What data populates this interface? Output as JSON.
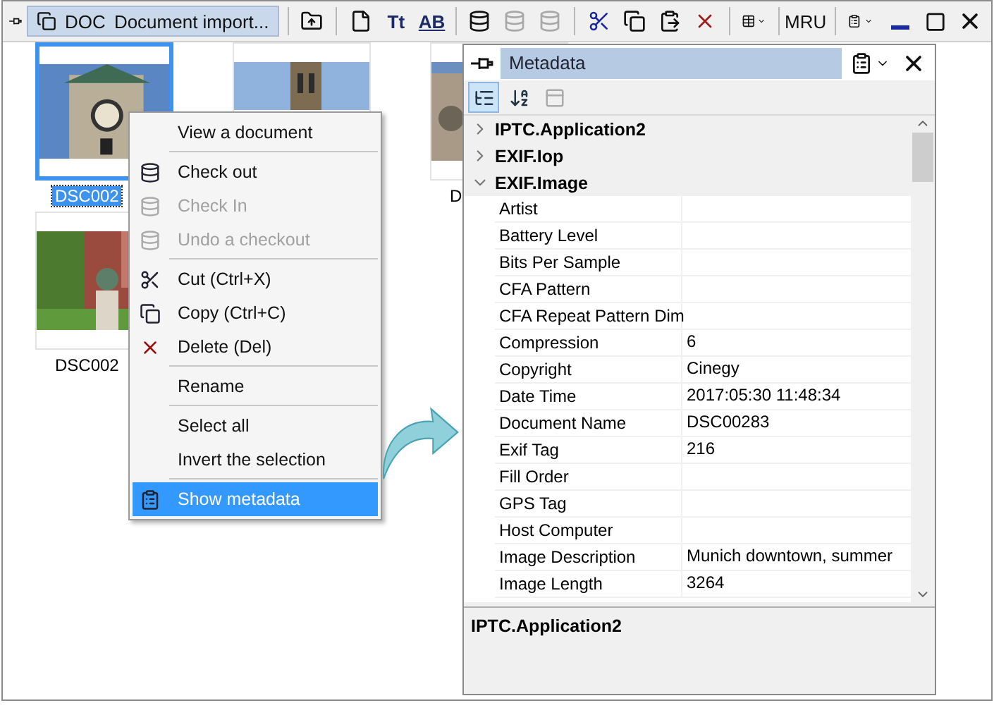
{
  "toolbar": {
    "tab": {
      "code": "DOC",
      "label": "Document import..."
    },
    "buttons": [
      {
        "kind": "icon",
        "disabled": false
      },
      {
        "kind": "separator"
      },
      {
        "kind": "icon",
        "disabled": false
      },
      {
        "kind": "glyph",
        "label": "Tt"
      },
      {
        "kind": "glyph",
        "label": "AB"
      },
      {
        "kind": "separator"
      },
      {
        "kind": "icon",
        "disabled": false
      },
      {
        "kind": "icon",
        "disabled": true
      },
      {
        "kind": "icon",
        "disabled": true
      },
      {
        "kind": "separator"
      },
      {
        "kind": "icon",
        "disabled": false
      },
      {
        "kind": "icon",
        "disabled": false
      },
      {
        "kind": "icon",
        "disabled": false
      },
      {
        "kind": "icon",
        "disabled": false
      },
      {
        "kind": "separator"
      },
      {
        "kind": "icon",
        "disabled": false
      },
      {
        "kind": "separator"
      },
      {
        "kind": "text",
        "label": "MRU"
      },
      {
        "kind": "separator"
      },
      {
        "kind": "icon",
        "disabled": false
      }
    ]
  },
  "thumbnails": [
    {
      "label": "DSC002",
      "selected": true
    },
    {
      "selected": false
    },
    {
      "label": "D",
      "selected": false
    },
    {
      "label": "DSC002",
      "selected": false
    }
  ],
  "context_menu": [
    {
      "kind": "item",
      "label": "View a document",
      "disabled": false,
      "selected": false
    },
    {
      "kind": "separator"
    },
    {
      "kind": "item",
      "label": "Check out",
      "disabled": false,
      "selected": false
    },
    {
      "kind": "item",
      "label": "Check In",
      "disabled": true,
      "selected": false
    },
    {
      "kind": "item",
      "label": "Undo a checkout",
      "disabled": true,
      "selected": false
    },
    {
      "kind": "separator"
    },
    {
      "kind": "item",
      "label": "Cut (Ctrl+X)",
      "disabled": false,
      "selected": false
    },
    {
      "kind": "item",
      "label": "Copy (Ctrl+C)",
      "disabled": false,
      "selected": false
    },
    {
      "kind": "item",
      "label": "Delete (Del)",
      "disabled": false,
      "selected": false
    },
    {
      "kind": "separator"
    },
    {
      "kind": "item",
      "label": "Rename",
      "disabled": false,
      "selected": false
    },
    {
      "kind": "separator"
    },
    {
      "kind": "item",
      "label": "Select all",
      "disabled": false,
      "selected": false
    },
    {
      "kind": "item",
      "label": "Invert the selection",
      "disabled": false,
      "selected": false
    },
    {
      "kind": "separator"
    },
    {
      "kind": "item",
      "label": "Show metadata",
      "disabled": false,
      "selected": true
    }
  ],
  "metadata_panel": {
    "title": "Metadata",
    "toolbar": [
      {
        "kind": "categorized",
        "selected": true,
        "disabled": false
      },
      {
        "kind": "alphabetical",
        "selected": false,
        "disabled": false
      },
      {
        "kind": "pages",
        "selected": false,
        "disabled": true
      }
    ],
    "categories": [
      {
        "name": "IPTC.Application2",
        "expanded": false
      },
      {
        "name": "EXIF.Iop",
        "expanded": false
      },
      {
        "name": "EXIF.Image",
        "expanded": true,
        "children": [
          {
            "name": "Artist"
          },
          {
            "name": "Battery Level"
          },
          {
            "name": "Bits Per Sample"
          },
          {
            "name": "CFA Pattern"
          },
          {
            "name": "CFA Repeat Pattern Dim"
          },
          {
            "name": "Compression",
            "value": "6"
          },
          {
            "name": "Copyright",
            "value": "Cinegy"
          },
          {
            "name": "Date Time",
            "value": "2017:05:30 11:48:34"
          },
          {
            "name": "Document Name",
            "value": "DSC00283"
          },
          {
            "name": "Exif Tag",
            "value": "216"
          },
          {
            "name": "Fill Order"
          },
          {
            "name": "GPS Tag"
          },
          {
            "name": "Host Computer"
          },
          {
            "name": "Image Description",
            "value": "Munich downtown, summer"
          },
          {
            "name": "Image Length",
            "value": "3264"
          }
        ]
      }
    ],
    "description": {
      "title": "IPTC.Application2"
    }
  }
}
